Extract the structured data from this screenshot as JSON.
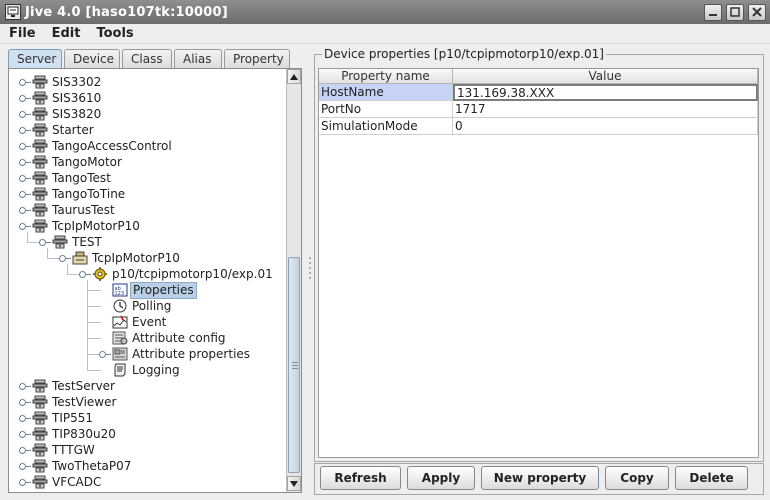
{
  "window": {
    "title": "Jive 4.0  [haso107tk:10000]"
  },
  "menus": [
    "File",
    "Edit",
    "Tools"
  ],
  "tabs": [
    {
      "label": "Server",
      "active": true
    },
    {
      "label": "Device",
      "active": false
    },
    {
      "label": "Class",
      "active": false
    },
    {
      "label": "Alias",
      "active": false
    },
    {
      "label": "Property",
      "active": false
    }
  ],
  "tree": {
    "items": [
      {
        "label": "SIS3302",
        "level": 0,
        "icon": "server-icon",
        "toggle": true
      },
      {
        "label": "SIS3610",
        "level": 0,
        "icon": "server-icon",
        "toggle": true
      },
      {
        "label": "SIS3820",
        "level": 0,
        "icon": "server-icon",
        "toggle": true
      },
      {
        "label": "Starter",
        "level": 0,
        "icon": "server-icon",
        "toggle": true
      },
      {
        "label": "TangoAccessControl",
        "level": 0,
        "icon": "server-icon",
        "toggle": true
      },
      {
        "label": "TangoMotor",
        "level": 0,
        "icon": "server-icon",
        "toggle": true
      },
      {
        "label": "TangoTest",
        "level": 0,
        "icon": "server-icon",
        "toggle": true
      },
      {
        "label": "TangoToTine",
        "level": 0,
        "icon": "server-icon",
        "toggle": true
      },
      {
        "label": "TaurusTest",
        "level": 0,
        "icon": "server-icon",
        "toggle": true
      },
      {
        "label": "TcpIpMotorP10",
        "level": 0,
        "icon": "server-icon",
        "toggle": true
      },
      {
        "label": "TEST",
        "level": 1,
        "icon": "server-icon",
        "toggle": true
      },
      {
        "label": "TcpIpMotorP10",
        "level": 2,
        "icon": "class-icon",
        "toggle": true
      },
      {
        "label": "p10/tcpipmotorp10/exp.01",
        "level": 3,
        "icon": "device-icon",
        "toggle": true
      },
      {
        "label": "Properties",
        "level": 4,
        "icon": "properties-icon",
        "toggle": false,
        "selected": true
      },
      {
        "label": "Polling",
        "level": 4,
        "icon": "polling-icon",
        "toggle": false
      },
      {
        "label": "Event",
        "level": 4,
        "icon": "event-icon",
        "toggle": false
      },
      {
        "label": "Attribute config",
        "level": 4,
        "icon": "attribute-config-icon",
        "toggle": false
      },
      {
        "label": "Attribute properties",
        "level": 4,
        "icon": "attribute-properties-icon",
        "toggle": true
      },
      {
        "label": "Logging",
        "level": 4,
        "icon": "logging-icon",
        "toggle": false
      },
      {
        "label": "TestServer",
        "level": 0,
        "icon": "server-icon",
        "toggle": true
      },
      {
        "label": "TestViewer",
        "level": 0,
        "icon": "server-icon",
        "toggle": true
      },
      {
        "label": "TIP551",
        "level": 0,
        "icon": "server-icon",
        "toggle": true
      },
      {
        "label": "TIP830u20",
        "level": 0,
        "icon": "server-icon",
        "toggle": true
      },
      {
        "label": "TTTGW",
        "level": 0,
        "icon": "server-icon",
        "toggle": true
      },
      {
        "label": "TwoThetaP07",
        "level": 0,
        "icon": "server-icon",
        "toggle": true
      },
      {
        "label": "VFCADC",
        "level": 0,
        "icon": "server-icon",
        "toggle": true
      }
    ]
  },
  "panel": {
    "title": "Device properties [p10/tcpipmotorp10/exp.01]",
    "columns": [
      "Property name",
      "Value"
    ],
    "rows": [
      {
        "name": "HostName",
        "value": "131.169.38.XXX"
      },
      {
        "name": "PortNo",
        "value": "1717"
      },
      {
        "name": "SimulationMode",
        "value": "0"
      }
    ]
  },
  "buttons": [
    "Refresh",
    "Apply",
    "New property",
    "Copy",
    "Delete"
  ]
}
